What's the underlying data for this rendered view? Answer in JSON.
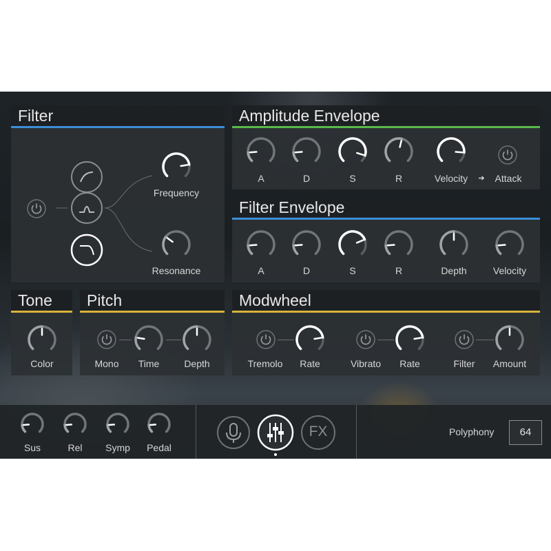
{
  "filter": {
    "title": "Filter",
    "frequency_label": "Frequency",
    "resonance_label": "Resonance",
    "frequency_value": 0.8,
    "resonance_value": 0.3
  },
  "amp_env": {
    "title": "Amplitude Envelope",
    "knobs": [
      {
        "label": "A",
        "value": 0.15
      },
      {
        "label": "D",
        "value": 0.15
      },
      {
        "label": "S",
        "value": 0.9
      },
      {
        "label": "R",
        "value": 0.55
      },
      {
        "label": "Velocity",
        "value": 0.85
      }
    ],
    "velocity_arrow": "➔",
    "attack_label": "Attack"
  },
  "filter_env": {
    "title": "Filter Envelope",
    "knobs": [
      {
        "label": "A",
        "value": 0.15
      },
      {
        "label": "D",
        "value": 0.15
      },
      {
        "label": "S",
        "value": 0.75
      },
      {
        "label": "R",
        "value": 0.15
      },
      {
        "label": "Depth",
        "value": 0.5
      },
      {
        "label": "Velocity",
        "value": 0.15
      }
    ]
  },
  "tone": {
    "title": "Tone",
    "color_label": "Color",
    "color_value": 0.5
  },
  "pitch": {
    "title": "Pitch",
    "mono_label": "Mono",
    "time_label": "Time",
    "time_value": 0.2,
    "depth_label": "Depth",
    "depth_value": 0.5
  },
  "modwheel": {
    "title": "Modwheel",
    "tremolo_label": "Tremolo",
    "rate1_label": "Rate",
    "rate1_value": 0.8,
    "vibrato_label": "Vibrato",
    "rate2_label": "Rate",
    "rate2_value": 0.8,
    "filter_label": "Filter",
    "amount_label": "Amount",
    "amount_value": 0.5
  },
  "bottom": {
    "knobs": [
      {
        "label": "Sus",
        "value": 0.15
      },
      {
        "label": "Rel",
        "value": 0.15
      },
      {
        "label": "Symp",
        "value": 0.15
      },
      {
        "label": "Pedal",
        "value": 0.15
      }
    ],
    "fx_label": "FX",
    "polyphony_label": "Polyphony",
    "polyphony_value": "64"
  },
  "colors": {
    "accent_blue": "#3c8fd8",
    "accent_green": "#5ab84a",
    "accent_yellow": "#d9b43a"
  }
}
